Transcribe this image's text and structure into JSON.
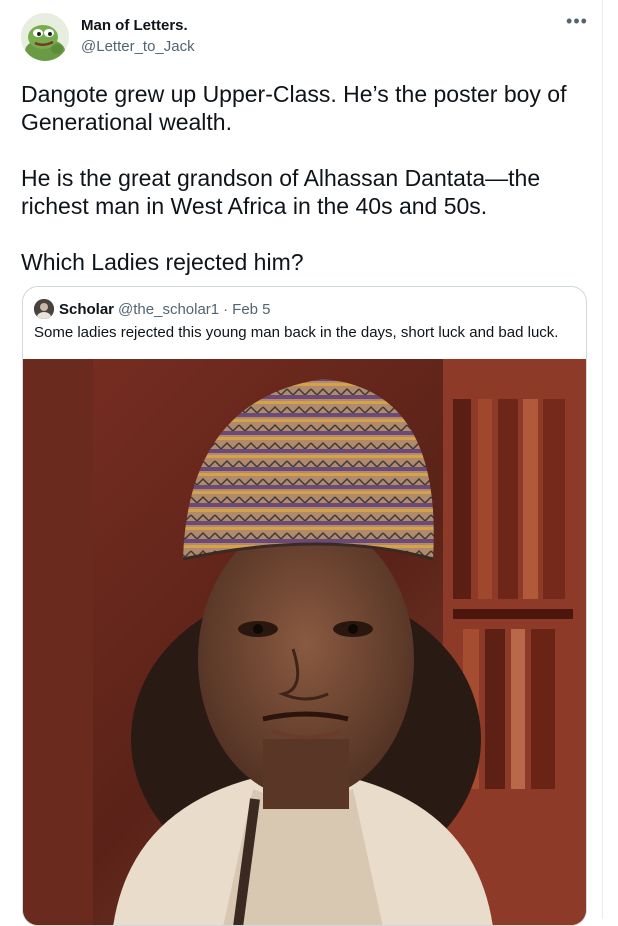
{
  "tweet": {
    "author_name": "Man of Letters.",
    "author_handle": "@Letter_to_Jack",
    "more_icon": "more-icon",
    "paragraphs": [
      "Dangote grew up Upper-Class. He’s the poster boy of Generational wealth.",
      "He is the great grandson of Alhassan Dantata—the richest man in West Africa in the 40s and 50s.",
      "Which Ladies rejected him?"
    ]
  },
  "quote": {
    "author_name": "Scholar",
    "author_handle": "@the_scholar1",
    "separator": "·",
    "date": "Feb 5",
    "text": "Some ladies rejected this young man back in the days, short luck and bad luck."
  },
  "colors": {
    "text": "#0f1419",
    "secondary": "#536471",
    "border": "#cfd9de"
  }
}
